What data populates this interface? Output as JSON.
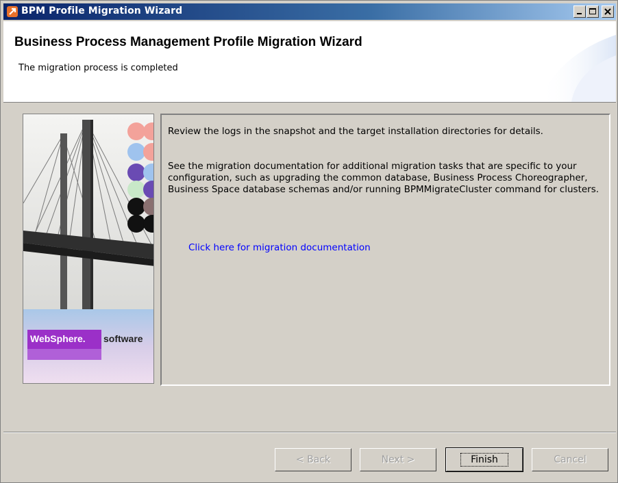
{
  "window": {
    "title": "BPM Profile Migration Wizard"
  },
  "banner": {
    "title": "Business Process Management Profile Migration Wizard",
    "subtitle": "The migration process is completed"
  },
  "sidepanel": {
    "brand": "WebSphere.",
    "brand_suffix": "software"
  },
  "content": {
    "paragraph1": "Review the logs in the snapshot and the target installation directories for details.",
    "paragraph2": "See the migration documentation for additional migration tasks that are specific to your configuration, such as upgrading the common database, Business Process Choreographer, Business Space database schemas and/or running BPMMigrateCluster command for clusters.",
    "link": "Click here for migration documentation"
  },
  "buttons": {
    "back": "< Back",
    "next": "Next >",
    "finish": "Finish",
    "cancel": "Cancel"
  },
  "icons": [
    "app-icon",
    "minimize-icon",
    "maximize-icon",
    "close-icon"
  ]
}
